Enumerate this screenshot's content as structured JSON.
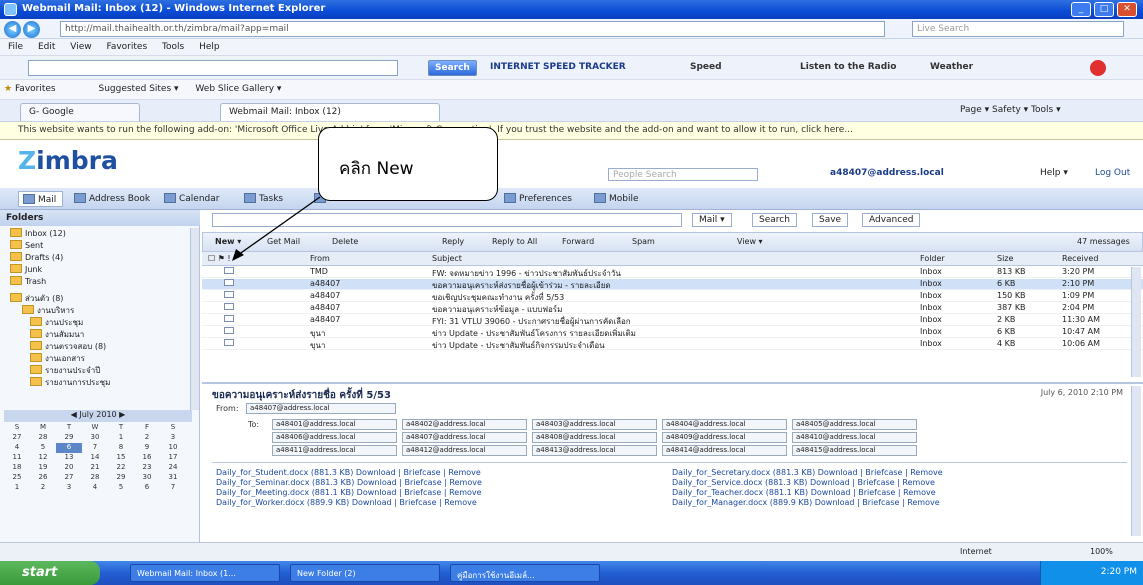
{
  "window": {
    "title": "Webmail Mail: Inbox (12) - Windows Internet Explorer",
    "min": "_",
    "max": "□",
    "close": "✕"
  },
  "address": {
    "url": "http://mail.thaihealth.or.th/zimbra/mail?app=mail",
    "search_placeholder": "Live Search"
  },
  "menu": [
    "File",
    "Edit",
    "View",
    "Favorites",
    "Tools",
    "Help"
  ],
  "toolbar": {
    "search_btn": "Search",
    "speed": "INTERNET SPEED TRACKER",
    "items": [
      "Speed",
      "Listen to the Radio",
      "Weather"
    ]
  },
  "favorites": {
    "label": "Favorites",
    "items": [
      "Suggested Sites ▾",
      "Web Slice Gallery ▾"
    ]
  },
  "tabs": {
    "google": "G- Google",
    "active": "Webmail Mail: Inbox (12)",
    "cmd": "Page ▾  Safety ▾  Tools ▾"
  },
  "infobar": "This website wants to run the following add-on: 'Microsoft Office Live Add-in' from 'Microsoft Corporation'. If you trust the website and the add-on and want to allow it to run, click here...",
  "zimbra": {
    "logo_a": "Z",
    "logo_b": "imbra",
    "search_placeholder": "People Search",
    "user": "a48407@address.local",
    "help": "Help ▾",
    "logout": "Log Out"
  },
  "apptabs": [
    "Mail",
    "Address Book",
    "Calendar",
    "Tasks",
    "Briefcase",
    "Preferences",
    "Mobile"
  ],
  "folders": {
    "header": "Folders",
    "items": [
      "Inbox (12)",
      "Sent",
      "Drafts (4)",
      "Junk",
      "Trash",
      "ส่วนตัว (8)",
      "งานบริหาร",
      "งานประชุม",
      "งานสัมมนา",
      "งานตรวจสอบ (8)",
      "งานเอกสาร",
      "รายงานประจำปี",
      "รายงานการประชุม"
    ]
  },
  "calendar": {
    "month": "July 2010",
    "days": [
      "S",
      "M",
      "T",
      "W",
      "T",
      "F",
      "S"
    ],
    "weeks": [
      [
        "27",
        "28",
        "29",
        "30",
        "1",
        "2",
        "3"
      ],
      [
        "4",
        "5",
        "6",
        "7",
        "8",
        "9",
        "10"
      ],
      [
        "11",
        "12",
        "13",
        "14",
        "15",
        "16",
        "17"
      ],
      [
        "18",
        "19",
        "20",
        "21",
        "22",
        "23",
        "24"
      ],
      [
        "25",
        "26",
        "27",
        "28",
        "29",
        "30",
        "31"
      ],
      [
        "1",
        "2",
        "3",
        "4",
        "5",
        "6",
        "7"
      ]
    ]
  },
  "search": {
    "mail_btn": "Mail ▾",
    "search_btn": "Search",
    "save": "Save",
    "advanced": "Advanced"
  },
  "actions": [
    "New ▾",
    "Get Mail",
    "Delete",
    "Reply",
    "Reply to All",
    "Forward",
    "Spam",
    "View ▾"
  ],
  "messages_count": "47 messages",
  "columns": {
    "from": "From",
    "subject": "Subject",
    "folder": "Folder",
    "size": "Size",
    "received": "Received"
  },
  "messages": [
    {
      "from": "TMD",
      "subject": "FW: จดหมายข่าว 1996 - ข่าวประชาสัมพันธ์ประจำวัน",
      "folder": "Inbox",
      "size": "813 KB",
      "time": "3:20 PM"
    },
    {
      "from": "a48407",
      "subject": "ขอความอนุเคราะห์ส่งรายชื่อผู้เข้าร่วม - รายละเอียด",
      "folder": "Inbox",
      "size": "6 KB",
      "time": "2:10 PM"
    },
    {
      "from": "a48407",
      "subject": "ขอเชิญประชุมคณะทำงาน ครั้งที่ 5/53",
      "folder": "Inbox",
      "size": "150 KB",
      "time": "1:09 PM"
    },
    {
      "from": "a48407",
      "subject": "ขอความอนุเคราะห์ข้อมูล - แบบฟอร์ม",
      "folder": "Inbox",
      "size": "387 KB",
      "time": "2:04 PM"
    },
    {
      "from": "a48407",
      "subject": "FYI: 31 VTLU 39060 - ประกาศรายชื่อผู้ผ่านการคัดเลือก",
      "folder": "Inbox",
      "size": "2 KB",
      "time": "11:30 AM"
    },
    {
      "from": "ขุนา",
      "subject": "ข่าว Update - ประชาสัมพันธ์โครงการ รายละเอียดเพิ่มเติม",
      "folder": "Inbox",
      "size": "6 KB",
      "time": "10:47 AM"
    },
    {
      "from": "ขุนา",
      "subject": "ข่าว Update - ประชาสัมพันธ์กิจกรรมประจำเดือน",
      "folder": "Inbox",
      "size": "4 KB",
      "time": "10:06 AM"
    }
  ],
  "reading": {
    "subject": "ขอความอนุเคราะห์ส่งรายชื่อ ครั้งที่ 5/53",
    "date": "July 6, 2010 2:10 PM",
    "from_label": "From:",
    "from": "a48407@address.local",
    "to_label": "To:",
    "recipients": [
      "a48401@address.local",
      "a48402@address.local",
      "a48403@address.local",
      "a48404@address.local",
      "a48405@address.local",
      "a48406@address.local",
      "a48407@address.local",
      "a48408@address.local",
      "a48409@address.local",
      "a48410@address.local",
      "a48411@address.local",
      "a48412@address.local",
      "a48413@address.local",
      "a48414@address.local",
      "a48415@address.local"
    ],
    "attachments": [
      "Daily_for_Student.docx (881.3 KB) Download | Briefcase | Remove",
      "Daily_for_Seminar.docx (881.3 KB) Download | Briefcase | Remove",
      "Daily_for_Meeting.docx (881.1 KB) Download | Briefcase | Remove",
      "Daily_for_Worker.docx (889.9 KB) Download | Briefcase | Remove",
      "Daily_for_Secretary.docx (881.3 KB) Download | Briefcase | Remove",
      "Daily_for_Service.docx (881.3 KB) Download | Briefcase | Remove",
      "Daily_for_Teacher.docx (881.1 KB) Download | Briefcase | Remove",
      "Daily_for_Manager.docx (889.9 KB) Download | Briefcase | Remove"
    ]
  },
  "status": {
    "zone": "Internet",
    "zoom": "100%"
  },
  "taskbar": {
    "start": "start",
    "tasks": [
      "Webmail Mail: Inbox (1...",
      "New Folder (2)",
      "คู่มือการใช้งานอีเมล์..."
    ],
    "clock": "2:20 PM"
  },
  "callout": "คลิก New"
}
